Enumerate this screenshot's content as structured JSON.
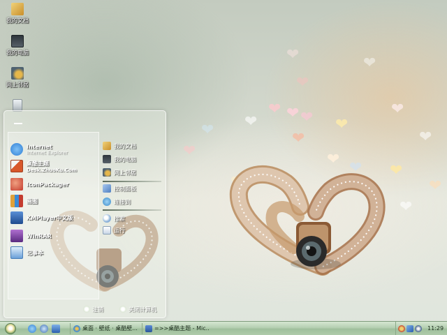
{
  "desktop": {
    "icons": [
      {
        "label": "我的文档",
        "icon": "folder-icon",
        "color": "#e2b64a"
      },
      {
        "label": "我的电脑",
        "icon": "computer-icon",
        "color": "#3a4750"
      },
      {
        "label": "网上邻居",
        "icon": "network-icon",
        "color": "#5a6f7c"
      },
      {
        "label": "",
        "icon": "recycle-bin-icon",
        "color": "#c9d3d8"
      }
    ]
  },
  "start_menu": {
    "pinned": [
      {
        "title": "Internet",
        "subtitle": "Internet Explorer",
        "icon": "ie-icon",
        "color": "#2f7fd6"
      },
      {
        "title": "桌酷主题",
        "subtitle": "Desk.ZhuoKu.Com",
        "icon": "zhuoku-icon",
        "color": "#d8572b"
      },
      {
        "title": "IconPackager",
        "subtitle": "",
        "icon": "iconpackager-icon",
        "color": "#c43c2f"
      },
      {
        "title": "画图",
        "subtitle": "",
        "icon": "paint-icon",
        "color": "#e0a13a"
      },
      {
        "title": "KMPlayer中文版",
        "subtitle": "",
        "icon": "kmplayer-icon",
        "color": "#2a5fae"
      },
      {
        "title": "WinRAR",
        "subtitle": "",
        "icon": "winrar-icon",
        "color": "#7a3f9e"
      },
      {
        "title": "记事本",
        "subtitle": "",
        "icon": "notepad-icon",
        "color": "#6aa0d8"
      }
    ],
    "right_items": [
      {
        "label": "我的文档",
        "icon": "folder-icon",
        "color": "#e2b64a"
      },
      {
        "label": "我的电脑",
        "icon": "computer-icon",
        "color": "#3a4750"
      },
      {
        "label": "网上邻居",
        "icon": "network-icon",
        "color": "#5a6f7c"
      },
      {
        "label": "控制面板",
        "icon": "control-panel-icon",
        "color": "#4f7fc0"
      },
      {
        "label": "连接到",
        "icon": "connect-icon",
        "color": "#3a8ac9"
      },
      {
        "label": "搜索",
        "icon": "search-icon",
        "color": "#8ab0d8"
      },
      {
        "label": "运行",
        "icon": "run-icon",
        "color": "#c8d6e6"
      }
    ],
    "logoff_label": "注销",
    "shutdown_label": "关闭计算机"
  },
  "taskbar": {
    "tasks": [
      {
        "label": "桌面 · 壁纸 · 桌酷壁...",
        "icon": "browser-icon",
        "color": "#3d8ad6"
      },
      {
        "label": "=>>桌酷主题 - Mic...",
        "icon": "word-icon",
        "color": "#2b579a"
      }
    ],
    "clock": "11:29"
  }
}
